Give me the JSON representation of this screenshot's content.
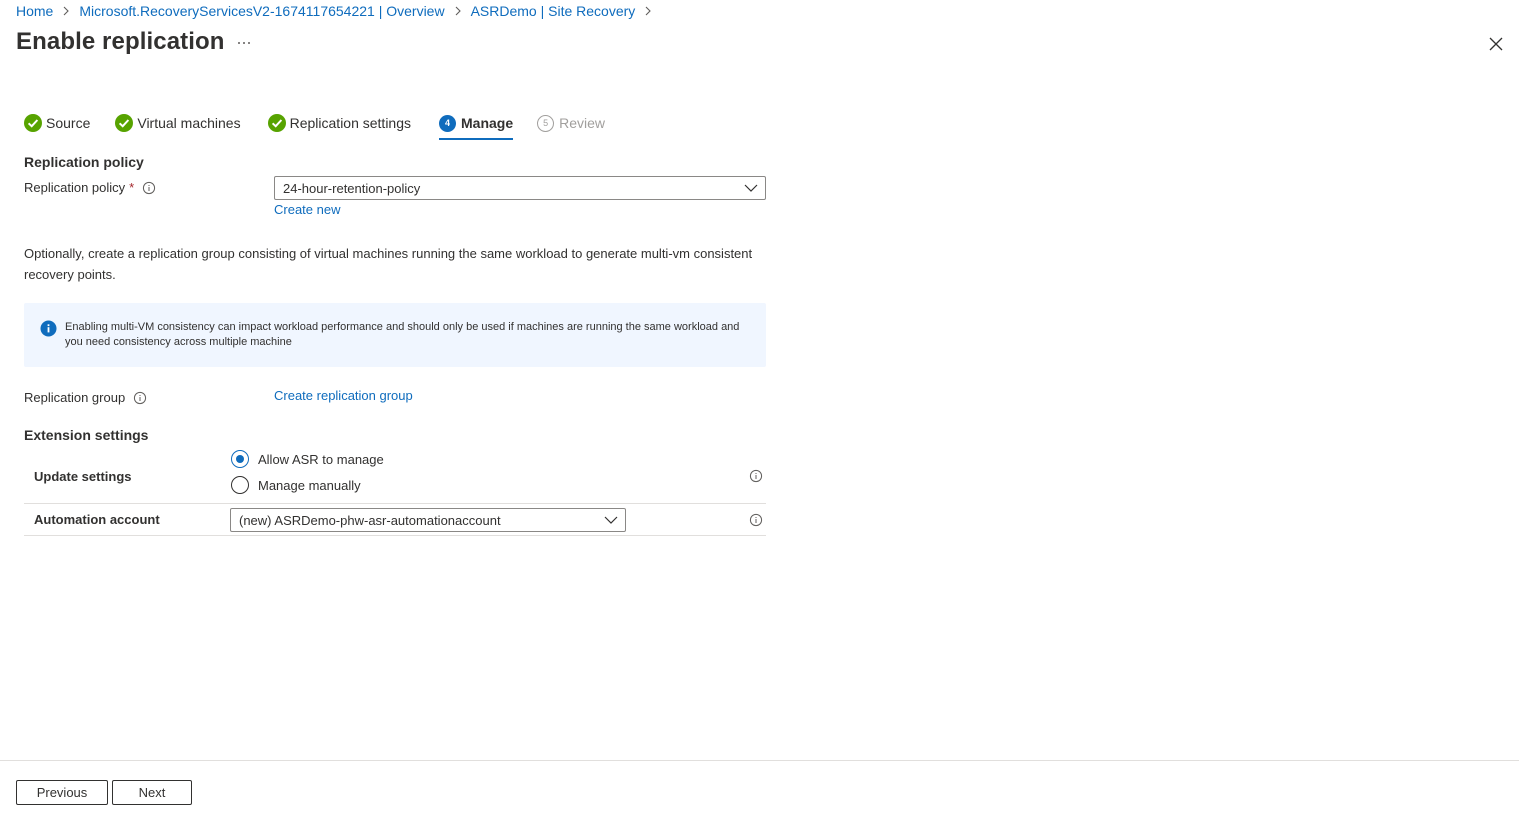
{
  "breadcrumb": {
    "items": [
      {
        "label": "Home"
      },
      {
        "label": "Microsoft.RecoveryServicesV2-1674117654221 | Overview"
      },
      {
        "label": "ASRDemo | Site Recovery"
      }
    ]
  },
  "page": {
    "title": "Enable replication"
  },
  "steps": [
    {
      "label": "Source",
      "state": "completed"
    },
    {
      "label": "Virtual machines",
      "state": "completed"
    },
    {
      "label": "Replication settings",
      "state": "completed"
    },
    {
      "label": "Manage",
      "state": "active",
      "number": "4"
    },
    {
      "label": "Review",
      "state": "disabled",
      "number": "5"
    }
  ],
  "replication_policy": {
    "heading": "Replication policy",
    "label": "Replication policy",
    "required_marker": "*",
    "selected": "24-hour-retention-policy",
    "create_new": "Create new"
  },
  "description": "Optionally, create a replication group consisting of virtual machines running the same workload to generate multi-vm consistent recovery points.",
  "info_box": {
    "text": "Enabling multi-VM consistency can impact workload performance and should only be used if machines are running the same workload and you need consistency across multiple machine"
  },
  "replication_group": {
    "label": "Replication group",
    "link": "Create replication group"
  },
  "extension_settings": {
    "heading": "Extension settings",
    "update_settings": {
      "label": "Update settings",
      "options": [
        "Allow ASR to manage",
        "Manage manually"
      ],
      "selected_index": 0
    },
    "automation_account": {
      "label": "Automation account",
      "selected": "(new) ASRDemo-phw-asr-automationaccount"
    }
  },
  "footer": {
    "previous": "Previous",
    "next": "Next"
  },
  "colors": {
    "accent": "#0f6cbd",
    "success": "#57a300",
    "required": "#a4262c",
    "info_bg": "#f0f6ff"
  }
}
